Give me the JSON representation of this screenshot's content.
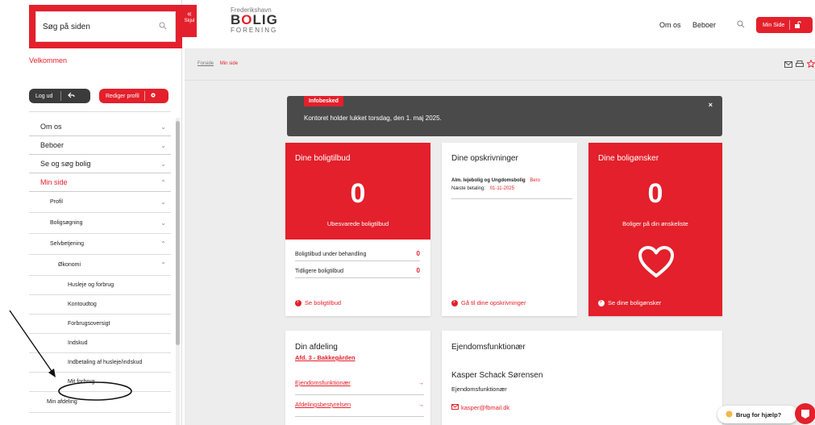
{
  "sidebar": {
    "search_placeholder": "Søg på siden",
    "hide_label": "Skjul",
    "welcome": "Velkommen",
    "logout_label": "Log ud",
    "edit_profile_label": "Rediger profil",
    "menu": {
      "about": "Om os",
      "resident": "Beboer",
      "search_home": "Se og søg bolig",
      "my_page": "Min side",
      "profile": "Profil",
      "housing_search": "Boligsøgning",
      "self_service": "Selvbetjening",
      "economy": "Økonomi",
      "rent_consumption": "Husleje og forbrug",
      "account_statement": "Kontoudtog",
      "consumption_overview": "Forbrugsoversigt",
      "deposit": "Indskud",
      "installment": "Indbetaling af husleje/indskud",
      "my_consumption": "Mit forbrug",
      "my_department": "Min afdeling"
    }
  },
  "header": {
    "logo_line1": "Frederikshavn",
    "logo_line2a": "B",
    "logo_line2b": "O",
    "logo_line2c": "LIG",
    "logo_line3": "FORENING",
    "nav_about": "Om os",
    "nav_resident": "Beboer",
    "my_page_button": "Min Side"
  },
  "breadcrumb": {
    "home": "Forside",
    "current": "Min side"
  },
  "info": {
    "badge": "Infobesked",
    "message": "Kontoret holder lukket torsdag, den 1. maj 2025.",
    "close": "×"
  },
  "offers": {
    "title": "Dine boligtilbud",
    "count": "0",
    "subtitle": "Ubesvarede boligtilbud",
    "row1_label": "Boligtilbud under behandling",
    "row1_value": "0",
    "row2_label": "Tidligere boligtilbud",
    "row2_value": "0",
    "link": "Se boligtilbud"
  },
  "registrations": {
    "title": "Dine opskrivninger",
    "item_title": "Alm. lejebolig og Ungdomsbolig",
    "item_status": "Bero",
    "next_payment_label": "Næste betaling:",
    "next_payment_date": "01-11-2025",
    "link": "Gå til dine opskrivninger"
  },
  "wishes": {
    "title": "Dine boligønsker",
    "count": "0",
    "subtitle": "Boliger på din ønskeliste",
    "link": "Se dine boligønsker"
  },
  "department": {
    "title": "Din afdeling",
    "name": "Afd. 3 - Bakkegården",
    "link1": "Ejendomsfunktionær",
    "link2": "Afdelingsbestyrelsen"
  },
  "staff": {
    "title": "Ejendomsfunktionær",
    "name": "Kasper Schack Sørensen",
    "role": "Ejendomsfunktionær",
    "email": "kasper@fbmail.dk"
  },
  "help": {
    "label": "Brug for hjælp?"
  },
  "colors": {
    "accent": "#e3202b",
    "dark": "#4a4a4a"
  }
}
